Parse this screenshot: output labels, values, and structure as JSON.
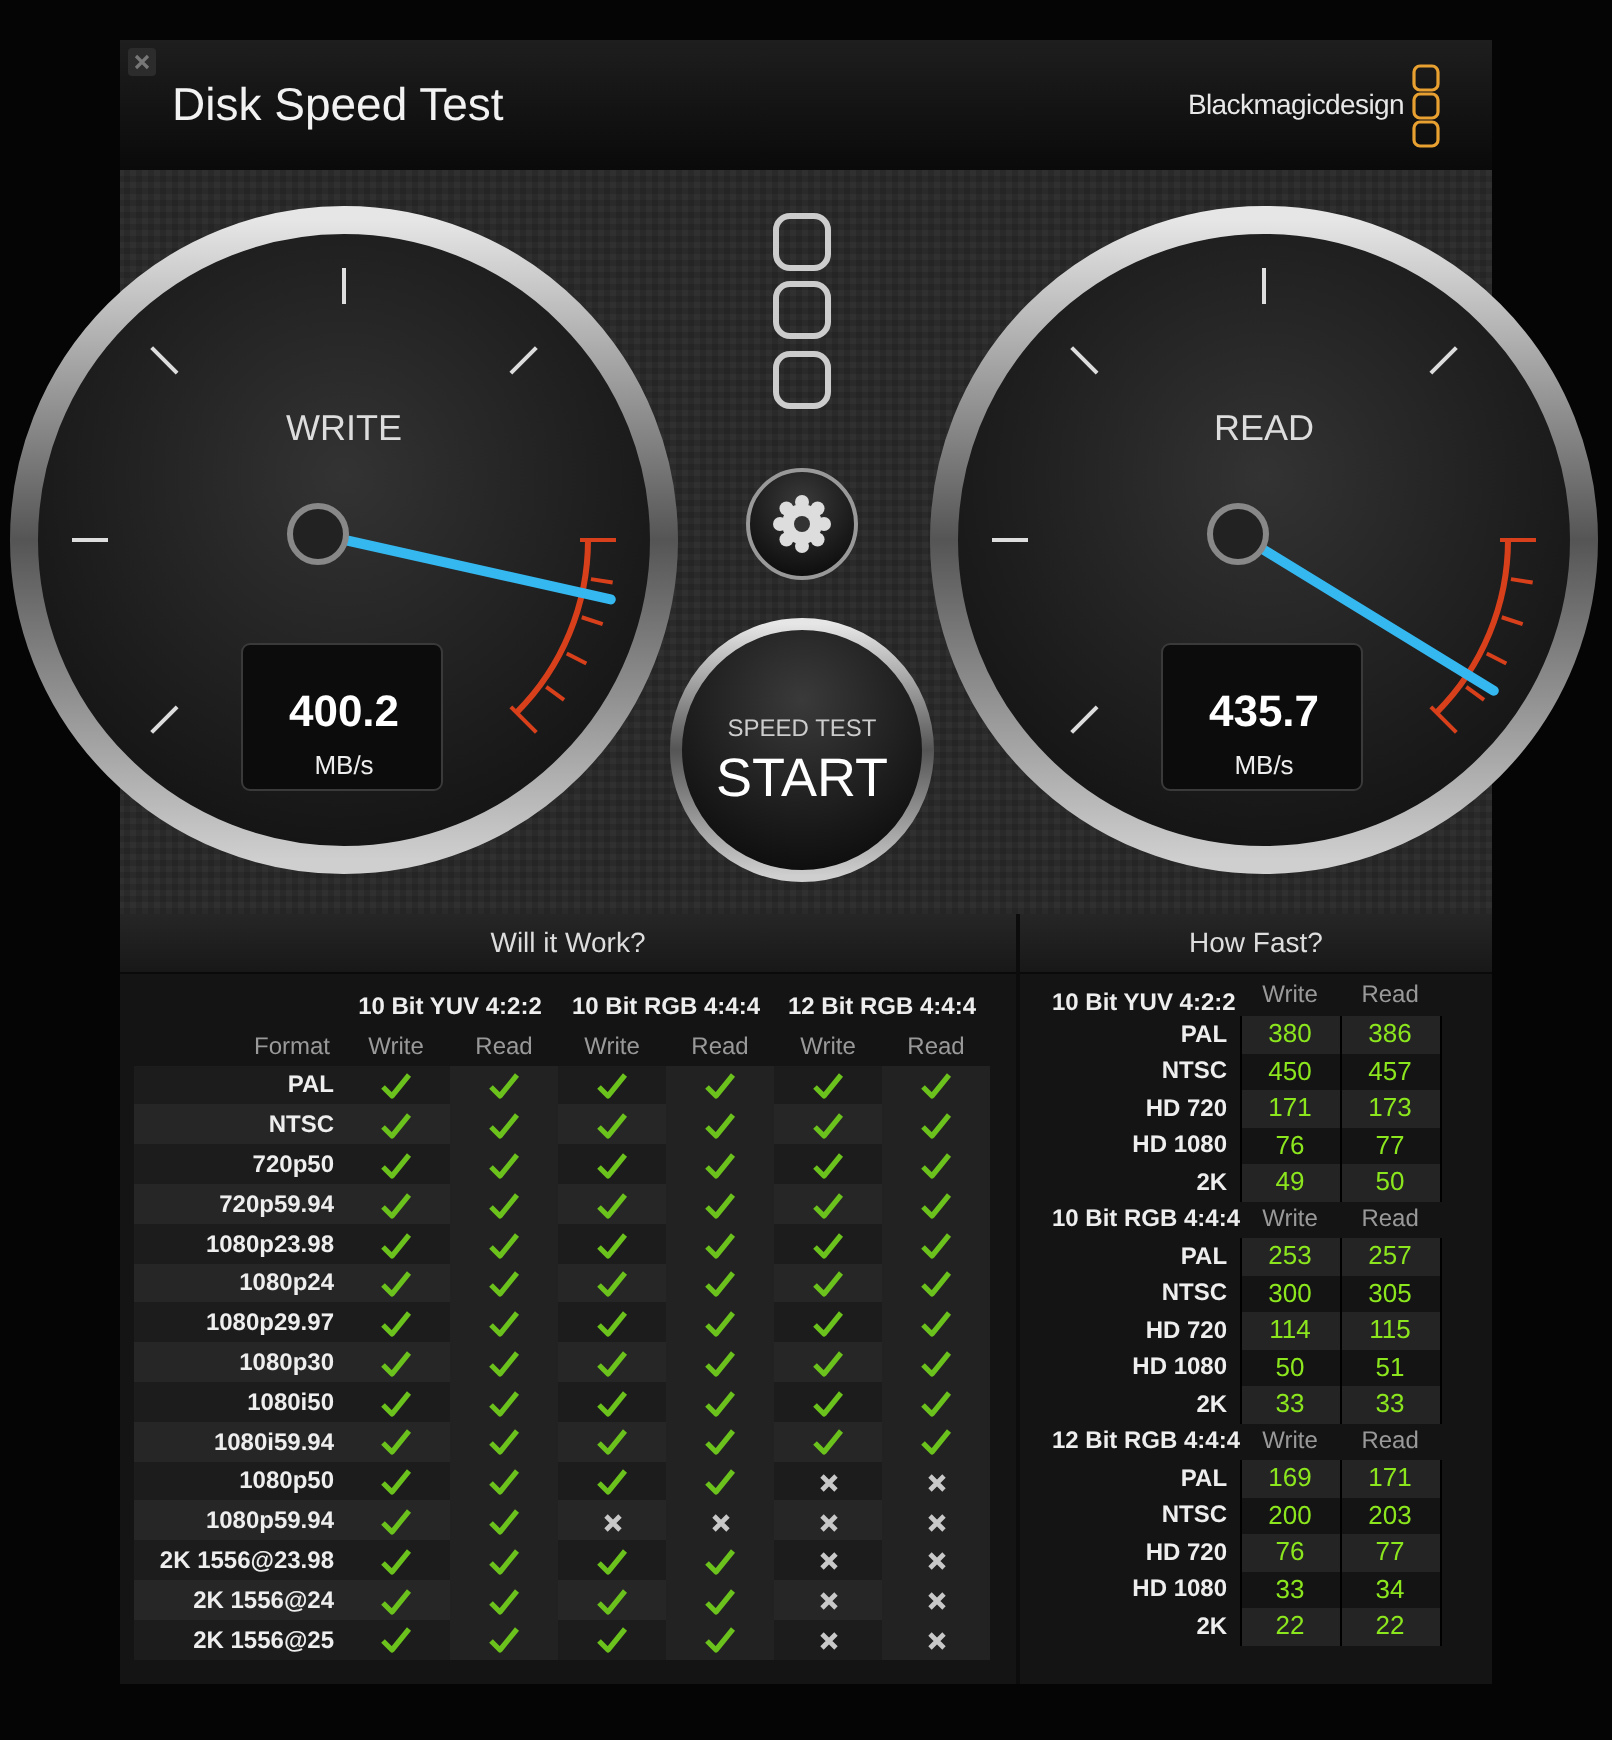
{
  "window": {
    "title": "Disk Speed Test",
    "brand": "Blackmagicdesign"
  },
  "gauges": [
    {
      "label": "WRITE",
      "value": "400.2",
      "unit": "MB/s",
      "level": 0.88
    },
    {
      "label": "READ",
      "value": "435.7",
      "unit": "MB/s",
      "level": 0.95
    }
  ],
  "start_button": {
    "caption": "SPEED TEST",
    "label": "START"
  },
  "will_it_work": {
    "title": "Will it Work?",
    "format_header": "Format",
    "groups": [
      {
        "name": "10 Bit YUV 4:2:2",
        "columns": [
          "Write",
          "Read"
        ]
      },
      {
        "name": "10 Bit RGB 4:4:4",
        "columns": [
          "Write",
          "Read"
        ]
      },
      {
        "name": "12 Bit RGB 4:4:4",
        "columns": [
          "Write",
          "Read"
        ]
      }
    ],
    "rows": [
      {
        "format": "PAL",
        "supported": [
          true,
          true,
          true,
          true,
          true,
          true
        ]
      },
      {
        "format": "NTSC",
        "supported": [
          true,
          true,
          true,
          true,
          true,
          true
        ]
      },
      {
        "format": "720p50",
        "supported": [
          true,
          true,
          true,
          true,
          true,
          true
        ]
      },
      {
        "format": "720p59.94",
        "supported": [
          true,
          true,
          true,
          true,
          true,
          true
        ]
      },
      {
        "format": "1080p23.98",
        "supported": [
          true,
          true,
          true,
          true,
          true,
          true
        ]
      },
      {
        "format": "1080p24",
        "supported": [
          true,
          true,
          true,
          true,
          true,
          true
        ]
      },
      {
        "format": "1080p29.97",
        "supported": [
          true,
          true,
          true,
          true,
          true,
          true
        ]
      },
      {
        "format": "1080p30",
        "supported": [
          true,
          true,
          true,
          true,
          true,
          true
        ]
      },
      {
        "format": "1080i50",
        "supported": [
          true,
          true,
          true,
          true,
          true,
          true
        ]
      },
      {
        "format": "1080i59.94",
        "supported": [
          true,
          true,
          true,
          true,
          true,
          true
        ]
      },
      {
        "format": "1080p50",
        "supported": [
          true,
          true,
          true,
          true,
          false,
          false
        ]
      },
      {
        "format": "1080p59.94",
        "supported": [
          true,
          true,
          false,
          false,
          false,
          false
        ]
      },
      {
        "format": "2K 1556@23.98",
        "supported": [
          true,
          true,
          true,
          true,
          false,
          false
        ]
      },
      {
        "format": "2K 1556@24",
        "supported": [
          true,
          true,
          true,
          true,
          false,
          false
        ]
      },
      {
        "format": "2K 1556@25",
        "supported": [
          true,
          true,
          true,
          true,
          false,
          false
        ]
      }
    ]
  },
  "how_fast": {
    "title": "How Fast?",
    "groups": [
      {
        "name": "10 Bit YUV 4:2:2",
        "write_header": "Write",
        "read_header": "Read",
        "rows": [
          {
            "format": "PAL",
            "write": "380",
            "read": "386"
          },
          {
            "format": "NTSC",
            "write": "450",
            "read": "457"
          },
          {
            "format": "HD 720",
            "write": "171",
            "read": "173"
          },
          {
            "format": "HD 1080",
            "write": "76",
            "read": "77"
          },
          {
            "format": "2K",
            "write": "49",
            "read": "50"
          }
        ]
      },
      {
        "name": "10 Bit RGB 4:4:4",
        "write_header": "Write",
        "read_header": "Read",
        "rows": [
          {
            "format": "PAL",
            "write": "253",
            "read": "257"
          },
          {
            "format": "NTSC",
            "write": "300",
            "read": "305"
          },
          {
            "format": "HD 720",
            "write": "114",
            "read": "115"
          },
          {
            "format": "HD 1080",
            "write": "50",
            "read": "51"
          },
          {
            "format": "2K",
            "write": "33",
            "read": "33"
          }
        ]
      },
      {
        "name": "12 Bit RGB 4:4:4",
        "write_header": "Write",
        "read_header": "Read",
        "rows": [
          {
            "format": "PAL",
            "write": "169",
            "read": "171"
          },
          {
            "format": "NTSC",
            "write": "200",
            "read": "203"
          },
          {
            "format": "HD 720",
            "write": "76",
            "read": "77"
          },
          {
            "format": "HD 1080",
            "write": "33",
            "read": "34"
          },
          {
            "format": "2K",
            "write": "22",
            "read": "22"
          }
        ]
      }
    ]
  }
}
